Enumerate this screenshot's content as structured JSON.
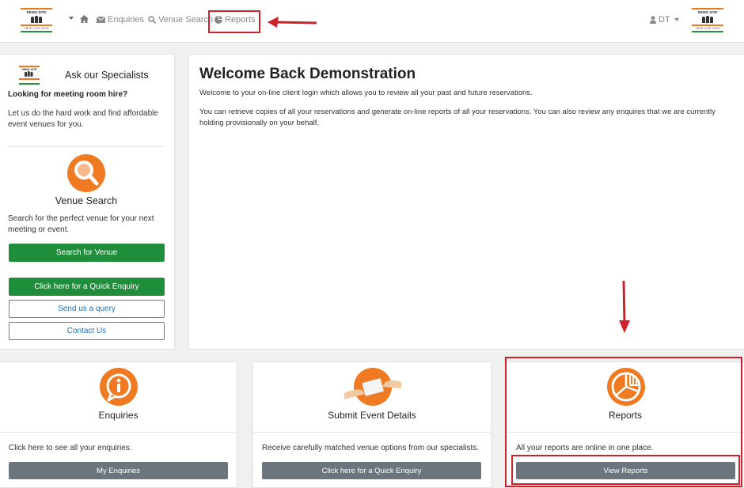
{
  "logo": {
    "title": "DEMO SITE",
    "subtitle": "TRUE LOVE VISTA"
  },
  "nav": {
    "enquiries": "Enquiries",
    "venue_search": "Venue Search",
    "reports": "Reports",
    "user": "DT"
  },
  "sidebar": {
    "heading": "Ask our Specialists",
    "looking": "Looking for meeting room hire?",
    "intro": "Let us do the hard work and find affordable event venues for you.",
    "venue_search_title": "Venue Search",
    "venue_search_desc": "Search for the perfect venue for your next meeting or event.",
    "search_button": "Search for Venue",
    "quick_enquiry_button": "Click here for a Quick Enquiry",
    "send_query_button": "Send us a query",
    "contact_button": "Contact Us"
  },
  "main": {
    "title": "Welcome Back Demonstration",
    "para1": "Welcome to your on-line client login which allows you to review all your past and future reservations.",
    "para2": "You can retrieve copies of all your reservations and generate on-line reports of all your reservations. You can also review any enquires that we are currently holding provisionally on your behalf."
  },
  "cards": {
    "enquiries": {
      "title": "Enquiries",
      "desc": "Click here to see all your enquiries.",
      "button": "My Enquiries"
    },
    "event": {
      "title": "Submit Event Details",
      "desc": "Receive carefully matched venue options from our specialists.",
      "button": "Click here for a Quick Enquiry"
    },
    "reports": {
      "title": "Reports",
      "desc": "All your reports are online in one place.",
      "button": "View Reports"
    }
  },
  "colors": {
    "accent_orange": "#ef7a22",
    "green_button": "#1f8e3a",
    "grey_button": "#6c757d",
    "annotation_red": "#d0202a"
  }
}
